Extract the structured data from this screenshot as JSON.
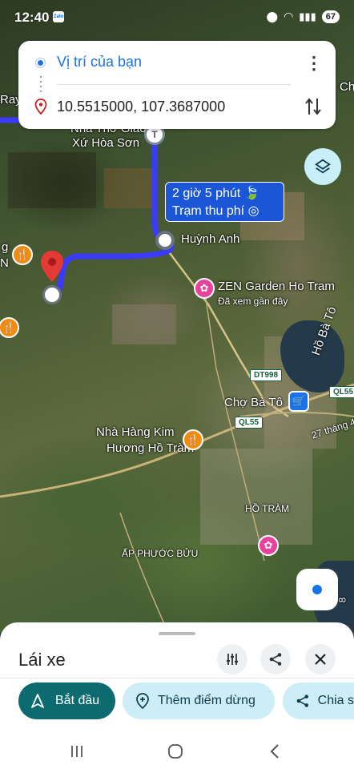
{
  "status_bar": {
    "time": "12:40",
    "app_icon_label": "Zalo",
    "battery": "67"
  },
  "route_card": {
    "origin": "Vị trí của bạn",
    "destination": "10.5515000, 107.3687000"
  },
  "route_info": {
    "duration": "2 giờ 5 phút",
    "via": "Trạm thu phí"
  },
  "map_labels": {
    "top_left": "Ray",
    "top_right": "Ch",
    "church": "Nhà Thờ Giáo",
    "church_line2": "Xứ Hòa Sơn",
    "huynh_anh": "Huỳnh Anh",
    "zen_garden": "ZEN Garden Ho Tram",
    "zen_sub": "Đã xem gần đây",
    "ho_ba_to": "Hồ Bà Tô",
    "cho_ba_to": "Chợ Bà Tô",
    "nha_hang_1": "Nhà Hàng Kim",
    "nha_hang_2": "Hương Hồ Tràm",
    "ho_tram": "HỒ TRÀM",
    "ap_phuoc_buu": "ẤP PHƯỚC BỬU",
    "street_27": "27 tháng 4",
    "left_g": "g",
    "left_n": "N",
    "right_8": "8"
  },
  "road_badges": {
    "dt998": "DT998",
    "ql55_a": "QL55",
    "ql55_b": "QL55"
  },
  "sheet": {
    "title": "Lái xe",
    "start_label": "Bắt đầu",
    "add_stop_label": "Thêm điểm dừng",
    "share_label": "Chia s"
  },
  "icons": {
    "origin": "blue-dot-icon",
    "destination": "location-pin-icon",
    "swap": "swap-icon",
    "layers": "layers-icon",
    "locate": "my-location-icon",
    "filter": "tune-icon",
    "share": "share-icon",
    "close": "close-icon",
    "navigate": "navigation-arrow-icon",
    "add_stop": "add-location-icon"
  },
  "colors": {
    "route": "#3b3bff",
    "accent": "#1a73e8",
    "primary_chip": "#0b6b6f",
    "secondary_chip": "#cdeef6",
    "pin": "#e53935"
  }
}
